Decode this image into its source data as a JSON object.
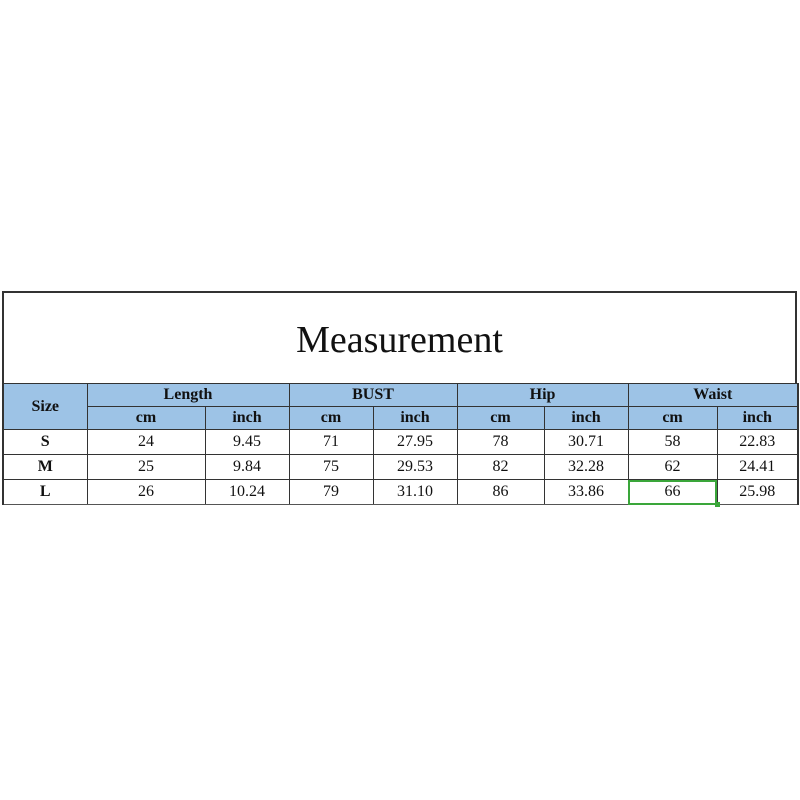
{
  "title": "Measurement",
  "header": {
    "size_label": "Size",
    "groups": [
      {
        "label": "Length",
        "cm": "cm",
        "inch": "inch"
      },
      {
        "label": "BUST",
        "cm": "cm",
        "inch": "inch"
      },
      {
        "label": "Hip",
        "cm": "cm",
        "inch": "inch"
      },
      {
        "label": "Waist",
        "cm": "cm",
        "inch": "inch"
      }
    ]
  },
  "rows": [
    {
      "size": "S",
      "values": [
        "24",
        "9.45",
        "71",
        "27.95",
        "78",
        "30.71",
        "58",
        "22.83"
      ]
    },
    {
      "size": "M",
      "values": [
        "25",
        "9.84",
        "75",
        "29.53",
        "82",
        "32.28",
        "62",
        "24.41"
      ]
    },
    {
      "size": "L",
      "values": [
        "26",
        "10.24",
        "79",
        "31.10",
        "86",
        "33.86",
        "66",
        "25.98"
      ]
    }
  ],
  "selected_cell": {
    "row": 2,
    "col": 6
  },
  "colors": {
    "header_bg": "#9dc3e6",
    "selection": "#3aa63a"
  }
}
